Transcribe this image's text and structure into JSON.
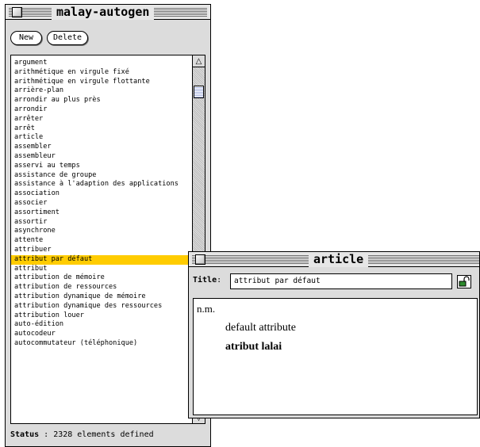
{
  "main_window": {
    "title": "malay-autogen",
    "new_label": "New",
    "delete_label": "Delete",
    "terms": [
      "argument",
      "arithmétique en virgule fixé",
      "arithmétique en virgule flottante",
      "arrière-plan",
      "arrondir au plus près",
      "arrondir",
      "arrêter",
      "arrêt",
      "article",
      "assembler",
      "assembleur",
      "asservi au temps",
      "assistance de groupe",
      "assistance à l'adaption des applications",
      "association",
      "associer",
      "assortiment",
      "assortir",
      "asynchrone",
      "attente",
      "attribuer",
      "attribut par défaut",
      "attribut",
      "attribution de mémoire",
      "attribution de ressources",
      "attribution dynamique de mémoire",
      "attribution dynamique des ressources",
      "attribution louer",
      "auto-édition",
      "autocodeur",
      "autocommutateur (téléphonique)"
    ],
    "selected_term": "attribut par défaut",
    "selection_color": "#ffcc00",
    "status_label": "Status",
    "status_text": "2328 elements defined"
  },
  "article_window": {
    "title": "article",
    "title_label": "Title",
    "title_value": "attribut par défaut",
    "definition": {
      "part_of_speech": "n.m.",
      "english": "default attribute",
      "malay": "atribut lalai"
    }
  },
  "icons": {
    "scroll_up": "up-arrow-icon",
    "scroll_down": "down-arrow-icon",
    "lock": "unlocked-padlock-icon"
  }
}
